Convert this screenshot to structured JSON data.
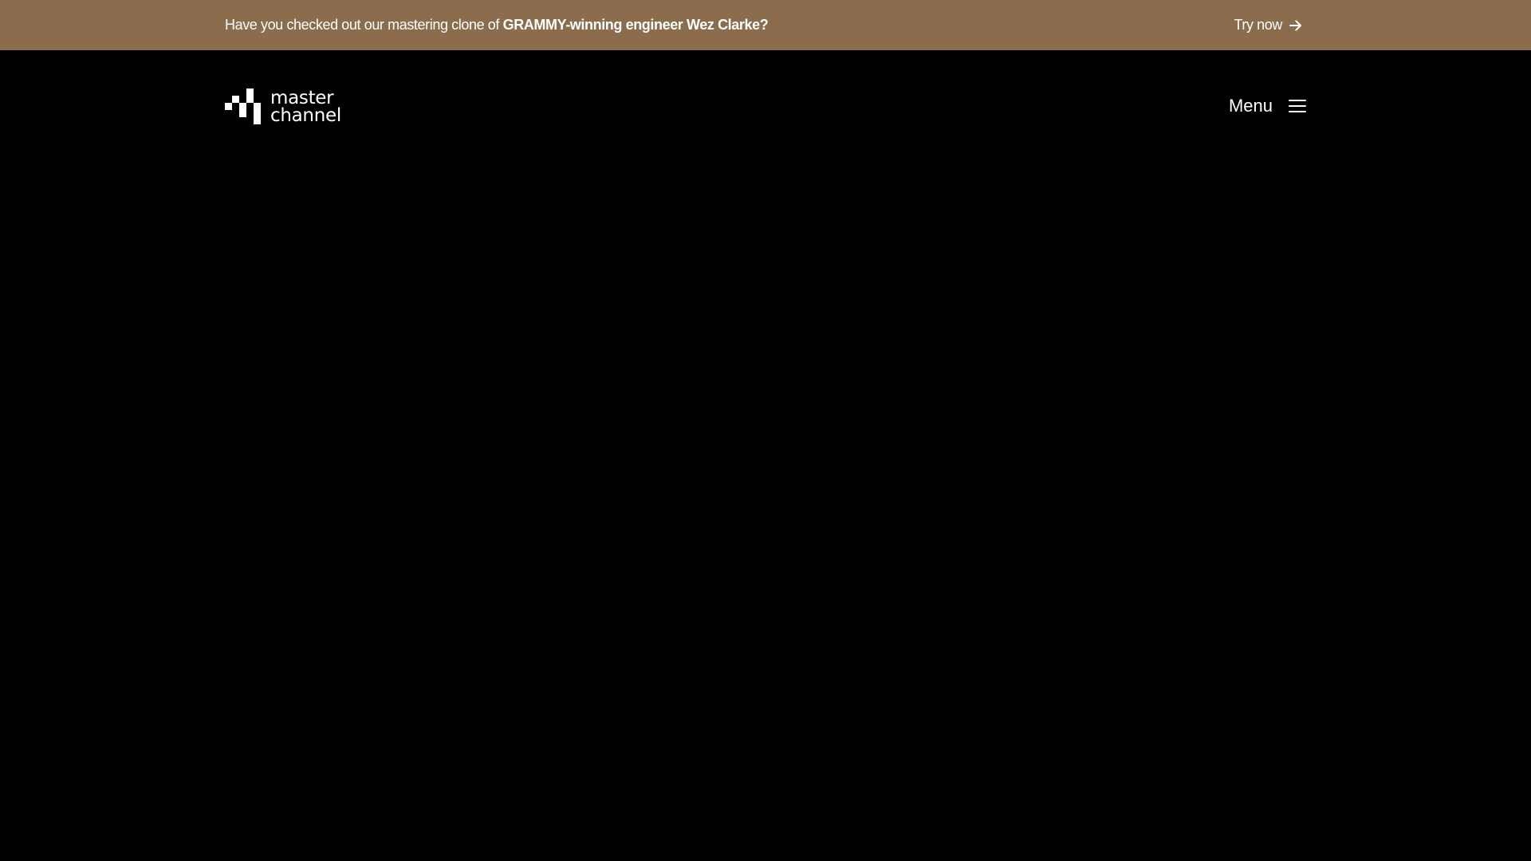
{
  "announcement": {
    "text_prefix": "Have you checked out our mastering clone of ",
    "text_highlight": "GRAMMY-winning engineer Wez Clarke?",
    "cta_label": "Try now",
    "background_color": "#8b6d4e"
  },
  "header": {
    "logo": {
      "line1": "master",
      "line2": "channel"
    },
    "menu_label": "Menu",
    "menu_icon": "hamburger-icon"
  }
}
